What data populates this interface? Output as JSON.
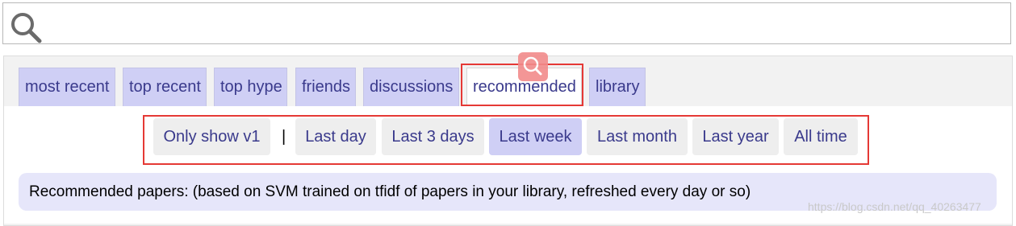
{
  "search": {
    "value": "",
    "placeholder": "",
    "icon": "search-icon"
  },
  "tabs": [
    {
      "label": "most recent",
      "active": false
    },
    {
      "label": "top recent",
      "active": false
    },
    {
      "label": "top hype",
      "active": false
    },
    {
      "label": "friends",
      "active": false
    },
    {
      "label": "discussions",
      "active": false
    },
    {
      "label": "recommended",
      "active": true
    },
    {
      "label": "library",
      "active": false
    }
  ],
  "filters": {
    "toggle_label": "Only show v1",
    "separator": "|",
    "time_ranges": [
      {
        "label": "Last day",
        "selected": false
      },
      {
        "label": "Last 3 days",
        "selected": false
      },
      {
        "label": "Last week",
        "selected": true
      },
      {
        "label": "Last month",
        "selected": false
      },
      {
        "label": "Last year",
        "selected": false
      },
      {
        "label": "All time",
        "selected": false
      }
    ]
  },
  "info_text": "Recommended papers: (based on SVM trained on tfidf of papers in your library, refreshed every day or so)",
  "watermark": "https://blog.csdn.net/qq_40263477",
  "colors": {
    "tab_bg": "#cfcff5",
    "link_text": "#3a3a8c",
    "highlight_red": "#e53935",
    "info_bg": "#e6e6fa"
  }
}
